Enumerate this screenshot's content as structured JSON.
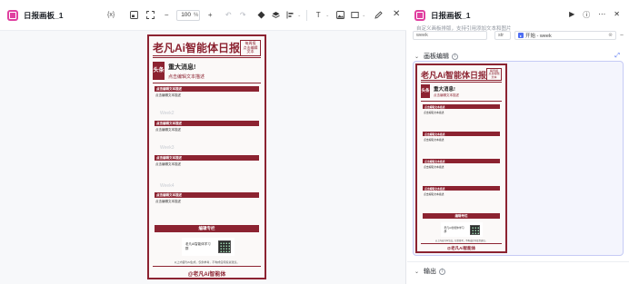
{
  "app": {
    "title": "日报画板_1",
    "zoom": "100",
    "zoom_unit": "%"
  },
  "toolbar": {
    "variable_label": "{x}"
  },
  "poster": {
    "title": "老凡Ai智能体日报",
    "badge_line1": "每周报",
    "badge_line2": "点击编辑文本",
    "news_tag": "头条",
    "news_headline": "重大消息!",
    "news_sub": "点击编辑文本描述",
    "sections": [
      {
        "title": "点击编辑文本描述",
        "text": "点击编辑文本描述"
      },
      {
        "title": "点击编辑文本描述",
        "text": "点击编辑文本描述"
      },
      {
        "title": "点击编辑文本描述",
        "text": "点击编辑文本描述"
      },
      {
        "title": "点击编辑文本描述",
        "text": "点击编辑文本描述"
      }
    ],
    "weeks": [
      "Week2",
      "Week3",
      "Week4"
    ],
    "footer_bar": "编辑专栏",
    "qr_text": "老凡Ai智能体学习群",
    "disclaimer": "以上内容为AI生成，仅供参考，不构成任何投资建议。",
    "signature": "@老凡Ai智能体"
  },
  "panel": {
    "title": "日报画板_1",
    "description": "自定义画板排版，支持引用添加文本和图片",
    "var_name": "week",
    "var_type": "str",
    "var_ref": "开始 - week",
    "section_canvas": "画板编辑",
    "section_output": "输出"
  },
  "colors": {
    "accent": "#8c2331",
    "brand": "#e040a0",
    "link": "#4e6ef2"
  }
}
